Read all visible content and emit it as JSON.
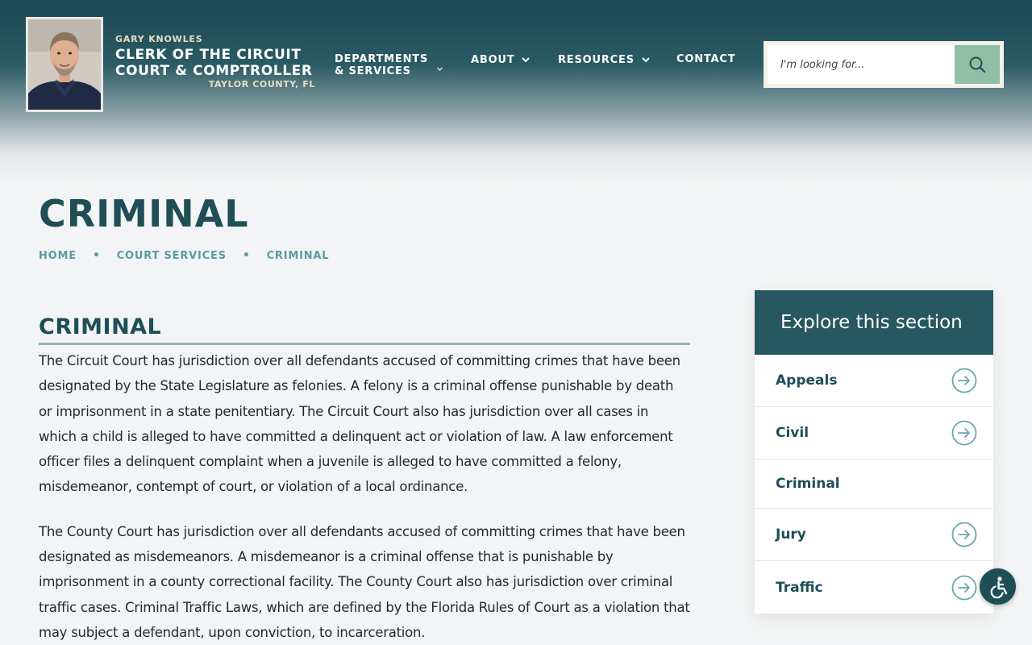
{
  "brand": {
    "official": "GARY KNOWLES",
    "title_line1": "CLERK OF THE CIRCUIT",
    "title_line2": "COURT & COMPTROLLER",
    "county": "TAYLOR COUNTY, FL"
  },
  "nav": {
    "departments_line1": "DEPARTMENTS",
    "departments_line2": "& SERVICES",
    "about": "ABOUT",
    "resources": "RESOURCES",
    "contact": "CONTACT"
  },
  "search": {
    "placeholder": "I'm looking for..."
  },
  "page": {
    "title": "CRIMINAL",
    "breadcrumb": [
      "HOME",
      "COURT SERVICES",
      "CRIMINAL"
    ]
  },
  "content": {
    "heading": "CRIMINAL",
    "paragraph1": "The Circuit Court has jurisdiction over all defendants accused of committing crimes that have been designated by the State Legislature as felonies. A felony is a criminal offense punishable by death or imprisonment in a state penitentiary. The Circuit Court also has jurisdiction over all cases in which a child is alleged to have committed a delinquent act or violation of law. A law enforcement officer files a delinquent complaint when a juvenile is alleged to have committed a felony, misdemeanor, contempt of court, or violation of a local ordinance.",
    "paragraph2": "The County Court has jurisdiction over all defendants accused of committing crimes that have been designated as misdemeanors. A misdemeanor is a criminal offense that is punishable by imprisonment in a county correctional facility. The County Court also has jurisdiction over criminal traffic cases. Criminal Traffic Laws, which are defined by the Florida Rules of Court as a violation that may subject a defendant, upon conviction, to incarceration."
  },
  "sidebar": {
    "heading": "Explore this section",
    "items": [
      {
        "label": "Appeals"
      },
      {
        "label": "Civil"
      },
      {
        "label": "Criminal"
      },
      {
        "label": "Jury"
      },
      {
        "label": "Traffic"
      }
    ]
  },
  "icons": {
    "search": "search-icon",
    "chevron": "chevron-down-icon",
    "arrow": "arrow-right-circle-icon",
    "accessibility": "accessibility-icon"
  },
  "colors": {
    "primary": "#275760",
    "accent": "#8fbfa6",
    "gold": "#e8dcc0",
    "link": "#5c9aa4"
  }
}
